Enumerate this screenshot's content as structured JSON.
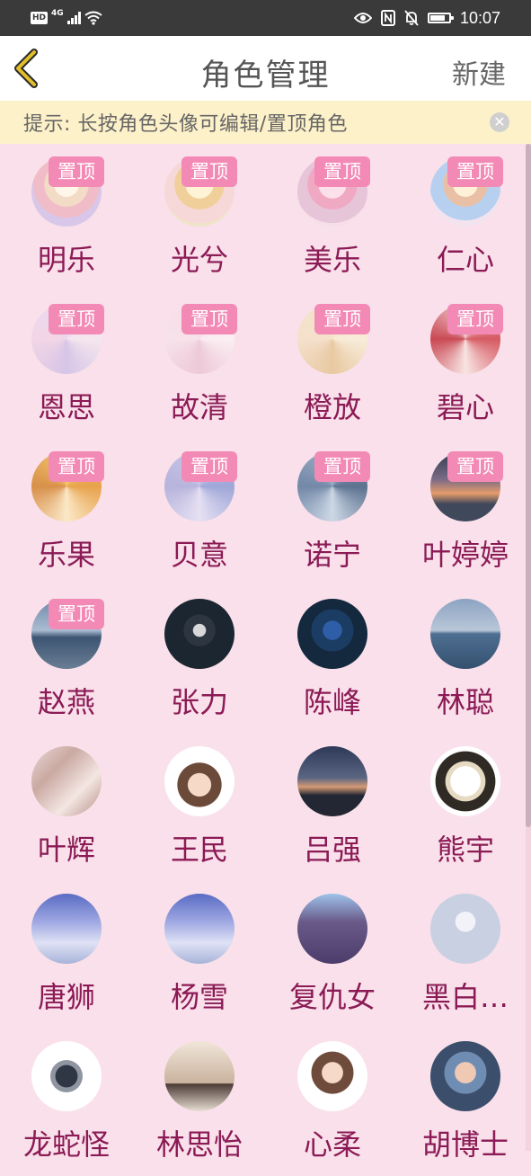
{
  "status_bar": {
    "hd": "HD",
    "network": "4G",
    "time": "10:07",
    "icons": [
      "hd-icon",
      "signal-icon",
      "wifi-icon",
      "eye-icon",
      "nfc-icon",
      "mute-bell-icon",
      "battery-icon"
    ]
  },
  "header": {
    "back_icon": "chevron-left-icon",
    "title": "角色管理",
    "new_button": "新建"
  },
  "tip": {
    "text": "提示: 长按角色头像可编辑/置顶角色",
    "close_icon": "close-icon"
  },
  "pin_label": "置顶",
  "colors": {
    "background": "#f9e0ea",
    "name": "#8b1a55",
    "pin_badge": "#f38ab6",
    "tip_bg": "#fdf1c9",
    "back_icon": "#d9b21b"
  },
  "characters": [
    {
      "name": "明乐",
      "pinned": true,
      "avatar": "av-pastel1"
    },
    {
      "name": "光兮",
      "pinned": true,
      "avatar": "av-pastel2"
    },
    {
      "name": "美乐",
      "pinned": true,
      "avatar": "av-pastel3"
    },
    {
      "name": "仁心",
      "pinned": true,
      "avatar": "av-pastel4"
    },
    {
      "name": "恩思",
      "pinned": true,
      "avatar": "av-lace1"
    },
    {
      "name": "故清",
      "pinned": true,
      "avatar": "av-lace2"
    },
    {
      "name": "橙放",
      "pinned": true,
      "avatar": "av-lace3"
    },
    {
      "name": "碧心",
      "pinned": true,
      "avatar": "av-red"
    },
    {
      "name": "乐果",
      "pinned": true,
      "avatar": "av-gold"
    },
    {
      "name": "贝意",
      "pinned": true,
      "avatar": "av-purple"
    },
    {
      "name": "诺宁",
      "pinned": true,
      "avatar": "av-steel"
    },
    {
      "name": "叶婷婷",
      "pinned": true,
      "avatar": "av-sunset"
    },
    {
      "name": "赵燕",
      "pinned": true,
      "avatar": "av-sea"
    },
    {
      "name": "张力",
      "pinned": false,
      "avatar": "av-dark"
    },
    {
      "name": "陈峰",
      "pinned": false,
      "avatar": "av-navy"
    },
    {
      "name": "林聪",
      "pinned": false,
      "avatar": "av-ocean"
    },
    {
      "name": "叶辉",
      "pinned": false,
      "avatar": "av-reed"
    },
    {
      "name": "王民",
      "pinned": false,
      "avatar": "av-cat"
    },
    {
      "name": "吕强",
      "pinned": false,
      "avatar": "av-dusk"
    },
    {
      "name": "熊宇",
      "pinned": false,
      "avatar": "av-meme"
    },
    {
      "name": "唐狮",
      "pinned": false,
      "avatar": "av-sky"
    },
    {
      "name": "杨雪",
      "pinned": false,
      "avatar": "av-sky"
    },
    {
      "name": "复仇女",
      "pinned": false,
      "avatar": "av-hero"
    },
    {
      "name": "黑白…",
      "pinned": false,
      "avatar": "av-default"
    },
    {
      "name": "龙蛇怪",
      "pinned": false,
      "avatar": "av-dragon"
    },
    {
      "name": "林思怡",
      "pinned": false,
      "avatar": "av-girl"
    },
    {
      "name": "心柔",
      "pinned": false,
      "avatar": "av-anime2"
    },
    {
      "name": "胡博士",
      "pinned": false,
      "avatar": "av-prof"
    }
  ]
}
